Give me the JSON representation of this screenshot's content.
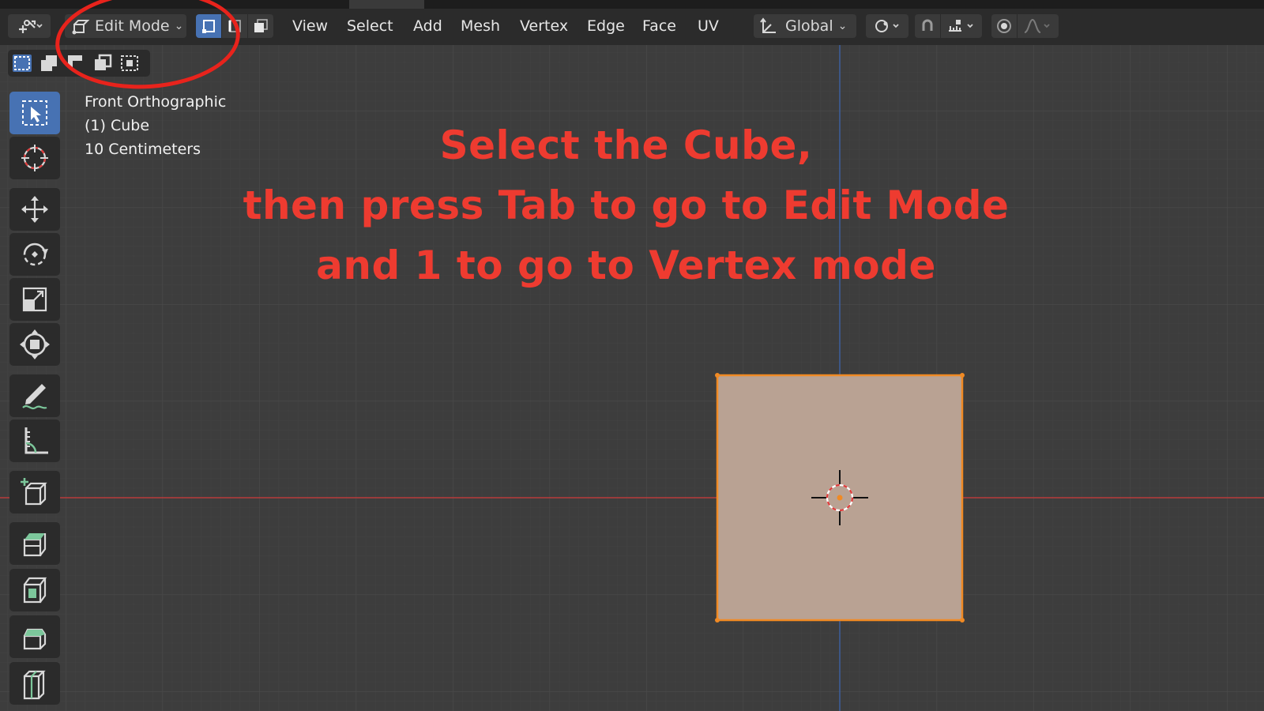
{
  "header": {
    "mode_label": "Edit Mode",
    "menus": [
      "View",
      "Select",
      "Add",
      "Mesh",
      "Vertex",
      "Edge",
      "Face",
      "UV"
    ],
    "orientation_label": "Global"
  },
  "viewport": {
    "view_name": "Front Orthographic",
    "object_label": "(1) Cube",
    "scale_label": "10 Centimeters"
  },
  "instructions": {
    "line1": "Select the Cube,",
    "line2": "then press Tab to go to Edit Mode",
    "line3": "and 1 to go to Vertex mode"
  },
  "colors": {
    "accent": "#4772b3",
    "annotation": "#ee3b30",
    "cube_fill": "#b9a293",
    "cube_outline": "#f08a24",
    "x_axis": "#b83b3b",
    "y_axis": "#3d5e9c",
    "background": "#3d3d3d"
  },
  "icons": {
    "editor_type": "editor-type-icon",
    "mode": "edit-mode-icon",
    "vertex_select": "vertex-select-icon",
    "edge_select": "edge-select-icon",
    "face_select": "face-select-icon",
    "pivot": "pivot-icon",
    "snap": "snap-icon",
    "proportional": "proportional-edit-icon"
  }
}
